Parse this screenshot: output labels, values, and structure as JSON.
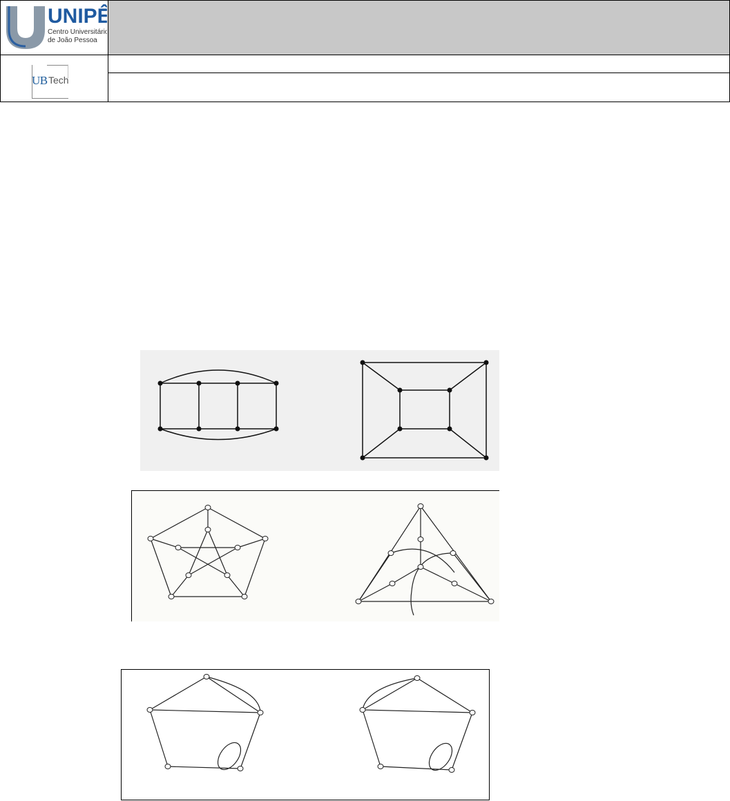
{
  "header": {
    "logo_name": "UNIPÊ",
    "logo_subtitle_line1": "Centro Universitário",
    "logo_subtitle_line2": "de João Pessoa",
    "secondary_logo_ub": "UB",
    "secondary_logo_tech": "Tech",
    "colors": {
      "brand_blue": "#1f5aa0",
      "logo_gray": "#8a99a8",
      "header_fill": "#c8c8c8"
    }
  },
  "figures": [
    {
      "id": "graph-pair-1",
      "description_type": "graph-drawings",
      "vertex_style": "filled"
    },
    {
      "id": "graph-pair-2",
      "description_type": "graph-drawings",
      "vertex_style": "hollow"
    },
    {
      "id": "graph-pair-3",
      "description_type": "graph-drawings",
      "vertex_style": "hollow"
    }
  ]
}
